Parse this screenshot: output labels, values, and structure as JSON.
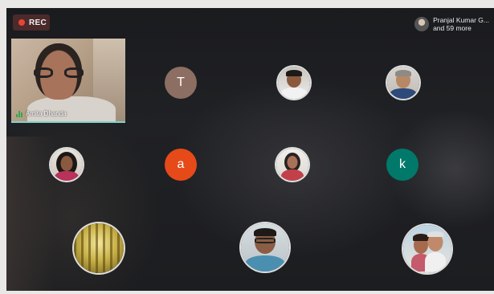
{
  "recording": {
    "label": "REC",
    "color": "#ea4335"
  },
  "participants_summary": {
    "line1": "Pranjal Kumar G...",
    "line2": "and 59 more"
  },
  "self_view": {
    "name": "Amita Dhanda",
    "accent": "#7fd3c8"
  },
  "letter_avatars": [
    {
      "letter": "T",
      "color": "#8d6e63"
    },
    {
      "letter": "a",
      "color": "#e64a19"
    },
    {
      "letter": "k",
      "color": "#00796b"
    }
  ],
  "photo_avatars": [
    {
      "icon": "man-with-glasses-photo-icon"
    },
    {
      "icon": "grey-haired-man-photo-icon"
    },
    {
      "icon": "young-woman-photo-icon"
    },
    {
      "icon": "woman-in-red-photo-icon"
    },
    {
      "icon": "forest-photo-icon"
    },
    {
      "icon": "bearded-man-photo-icon"
    },
    {
      "icon": "couple-selfie-photo-icon"
    }
  ]
}
